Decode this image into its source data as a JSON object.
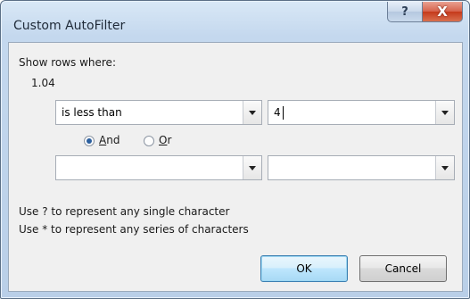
{
  "window": {
    "title": "Custom AutoFilter",
    "help_label": "?",
    "close_label": "X"
  },
  "dialog": {
    "show_rows_label": "Show rows where:",
    "column_name": "1.04",
    "criteria1": {
      "operator": "is less than",
      "value": "4"
    },
    "logic": {
      "and_prefix": "",
      "and_key": "A",
      "and_rest": "nd",
      "or_key": "O",
      "or_rest": "r",
      "selected": "And"
    },
    "criteria2": {
      "operator": "",
      "value": ""
    },
    "hint1": "Use ? to represent any single character",
    "hint2": "Use * to represent any series of characters",
    "ok_label": "OK",
    "cancel_label": "Cancel"
  }
}
